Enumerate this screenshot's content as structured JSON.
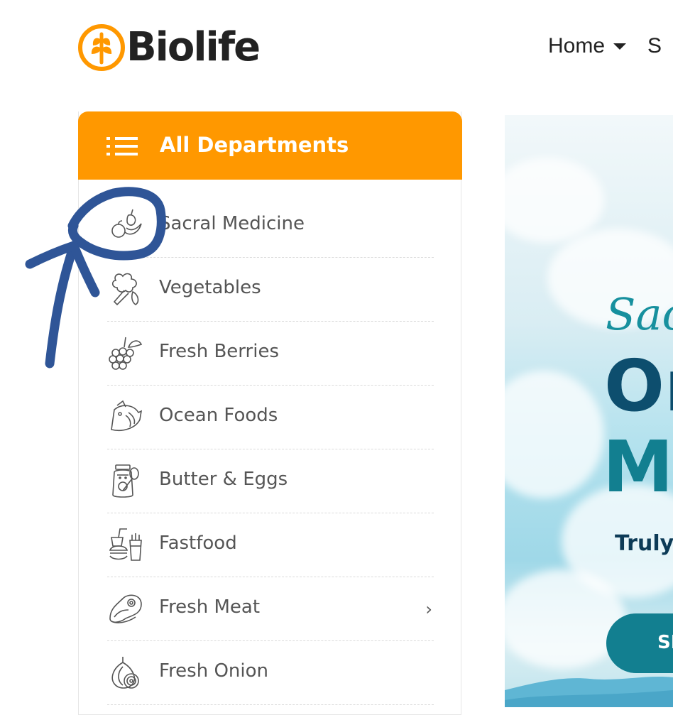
{
  "brand": {
    "name": "Biolife",
    "logo_icon": "wheat-leaf-icon",
    "logo_color": "#ff9800"
  },
  "nav": {
    "items": [
      {
        "label": "Home",
        "has_dropdown": true
      },
      {
        "label": "S"
      }
    ]
  },
  "departments": {
    "title": "All Departments",
    "menu_icon": "list-icon",
    "header_color": "#ff9800",
    "items": [
      {
        "label": "Sacral Medicine",
        "icon": "fruits-icon"
      },
      {
        "label": "Vegetables",
        "icon": "broccoli-icon"
      },
      {
        "label": "Fresh Berries",
        "icon": "berries-icon"
      },
      {
        "label": "Ocean Foods",
        "icon": "fish-icon"
      },
      {
        "label": "Butter & Eggs",
        "icon": "jar-icon"
      },
      {
        "label": "Fastfood",
        "icon": "fastfood-icon"
      },
      {
        "label": "Fresh Meat",
        "icon": "meat-icon",
        "has_submenu": true,
        "arrow": "›"
      },
      {
        "label": "Fresh Onion",
        "icon": "onion-icon"
      }
    ]
  },
  "hero": {
    "subtitle": "Sacr",
    "line1": "Or",
    "line2": "M",
    "tagline": "Truly",
    "button_label": "SI",
    "colors": {
      "subtitle": "#17909e",
      "line1": "#0d4e6e",
      "line2": "#127f90",
      "button": "#127f90"
    }
  },
  "annotation": {
    "type": "hand-drawn circle and arrow",
    "color": "#2f5597",
    "target": "fruits-icon"
  }
}
